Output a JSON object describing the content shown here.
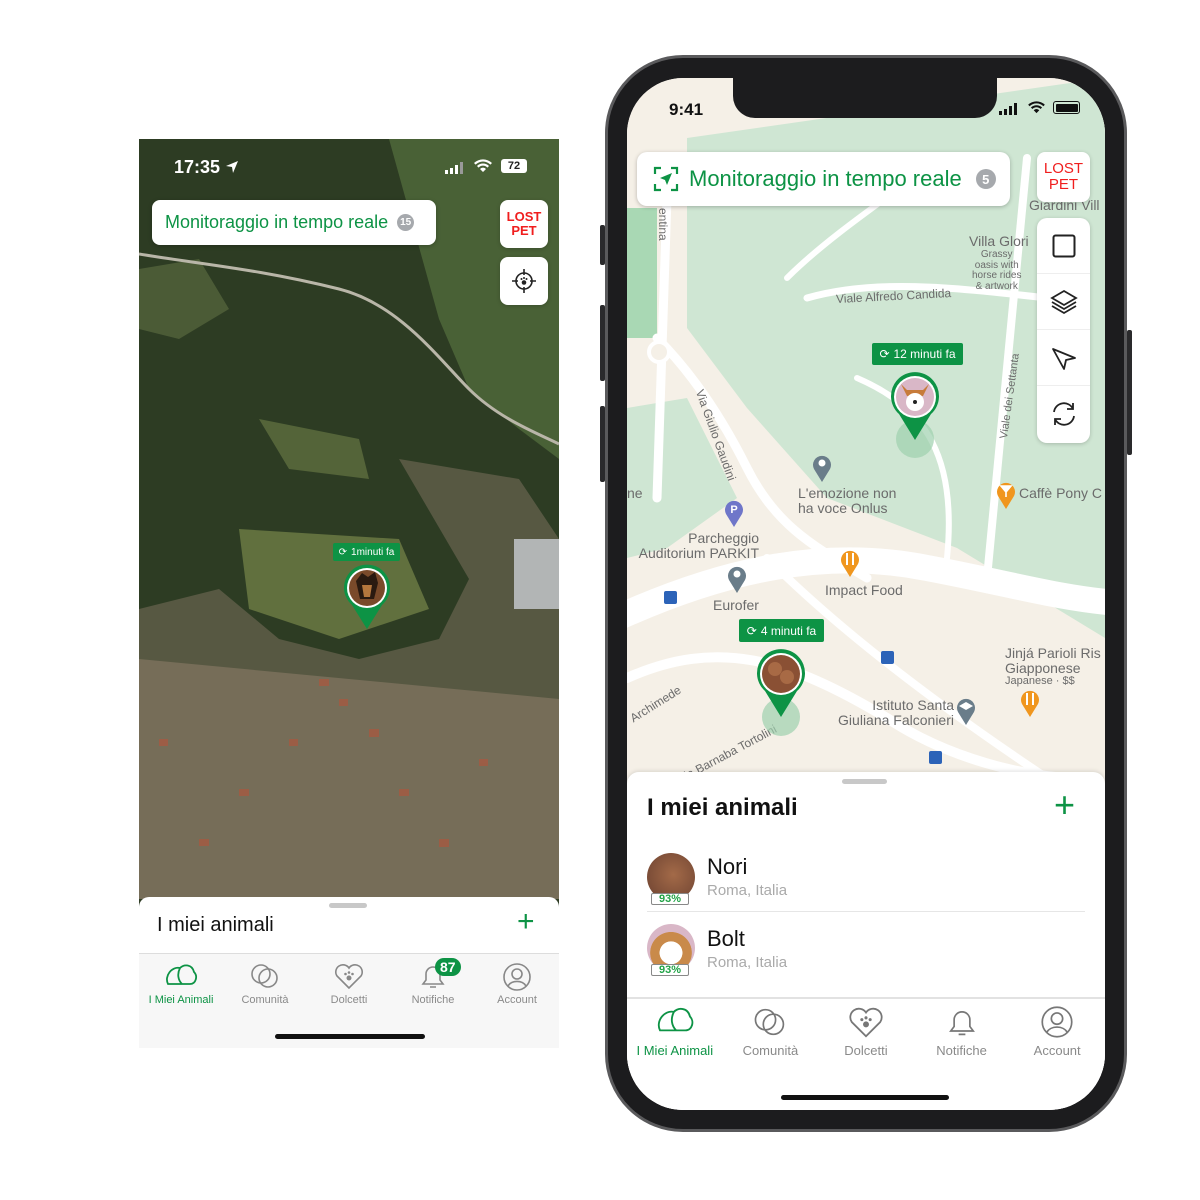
{
  "left_screen": {
    "status": {
      "time": "17:35",
      "battery": "72"
    },
    "header": {
      "title": "Monitoraggio in tempo reale",
      "count": "15"
    },
    "lost_pet": {
      "line1": "LOST",
      "line2": "PET"
    },
    "marker": {
      "time_ago": "1minuti fa"
    },
    "sheet": {
      "title": "I miei animali",
      "add": "+"
    },
    "tabs": [
      {
        "label": "I Miei Animali",
        "icon": "pets-icon"
      },
      {
        "label": "Comunità",
        "icon": "community-icon"
      },
      {
        "label": "Dolcetti",
        "icon": "heart-paw-icon"
      },
      {
        "label": "Notifiche",
        "icon": "bell-icon",
        "badge": "87"
      },
      {
        "label": "Account",
        "icon": "account-icon"
      }
    ]
  },
  "right_screen": {
    "status": {
      "time": "9:41"
    },
    "header": {
      "title": "Monitoraggio in tempo reale",
      "count": "5"
    },
    "lost_pet": {
      "line1": "LOST",
      "line2": "PET"
    },
    "tools": [
      "square-icon",
      "layers-icon",
      "navigate-icon",
      "refresh-icon"
    ],
    "markers": [
      {
        "pet": "Bolt",
        "time_ago": "12 minuti fa"
      },
      {
        "pet": "Nori",
        "time_ago": "4 minuti fa"
      }
    ],
    "map_labels": [
      "Giardini Vill",
      "Villa Glori",
      "Grassy\noasis with\nhorse rides\n& artwork",
      "Viale Alfredo Candida",
      "entina",
      "Via Giulio Gaudini",
      "Viale dei Settanta",
      "L'emozione non\nha voce Onlus",
      "Caffè Pony C",
      "Parcheggio\nAuditorium PARKIT",
      "Eurofer",
      "Impact Food",
      "Jinjá Parioli Ris\nGiapponese",
      "Japanese · $$",
      "Istituto Santa\nGiuliana Falconieri",
      "Archimede",
      "Via Barnaba Tortolini",
      "ne"
    ],
    "sheet": {
      "title": "I miei animali",
      "add": "+"
    },
    "pets": [
      {
        "name": "Nori",
        "location": "Roma, Italia",
        "battery": "93%"
      },
      {
        "name": "Bolt",
        "location": "Roma, Italia",
        "battery": "93%"
      }
    ],
    "tabs": [
      {
        "label": "I Miei Animali"
      },
      {
        "label": "Comunità"
      },
      {
        "label": "Dolcetti"
      },
      {
        "label": "Notifiche"
      },
      {
        "label": "Account"
      }
    ]
  },
  "colors": {
    "brand_green": "#0d9345",
    "lost_red": "#f01e1e",
    "badge_grey": "#a6a9ad"
  }
}
